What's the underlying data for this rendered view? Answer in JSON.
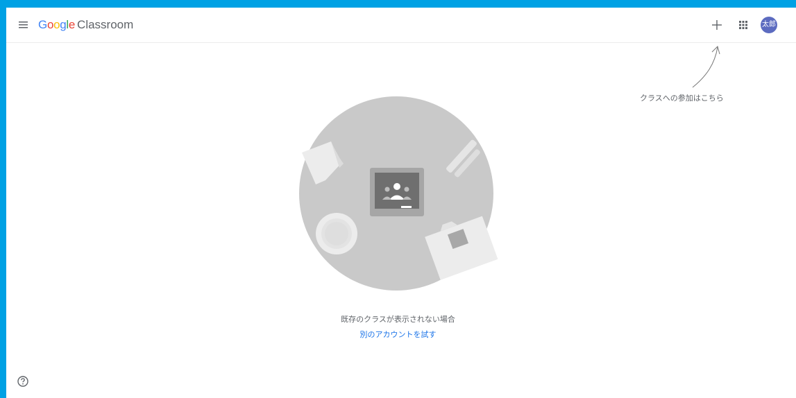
{
  "header": {
    "logo_word": [
      "G",
      "o",
      "o",
      "g",
      "l",
      "e"
    ],
    "product": "Classroom",
    "avatar_text": "太郎",
    "avatar_color": "#5c6bc0"
  },
  "icons": {
    "menu": "menu-icon",
    "add": "plus-icon",
    "apps": "apps-grid-icon",
    "help": "help-circle-icon"
  },
  "hint": {
    "text": "クラスへの参加はこちら"
  },
  "empty_state": {
    "message": "既存のクラスが表示されない場合",
    "link": "別のアカウントを試す"
  },
  "colors": {
    "frame": "#00a1e4",
    "link": "#1a73e8",
    "text": "#5f6368"
  }
}
